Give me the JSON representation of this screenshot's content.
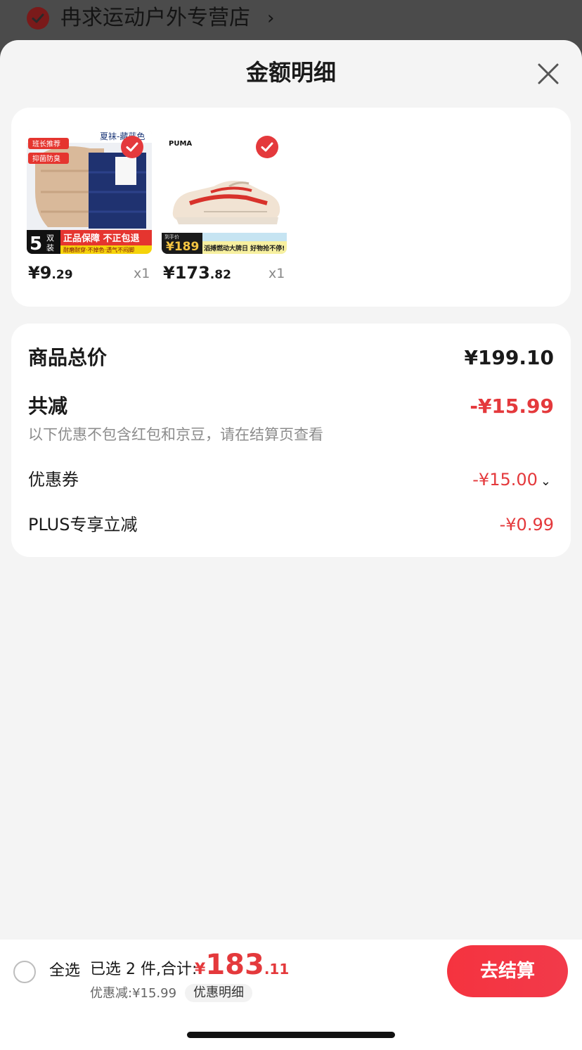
{
  "store": {
    "name": "冉求运动户外专营店",
    "chevron": "›",
    "check_icon": "check-circle-icon"
  },
  "sheet": {
    "title": "金额明细",
    "close_icon": "close-icon"
  },
  "products": [
    {
      "price_int": "¥9",
      "price_dec": ".29",
      "qty": "x1",
      "image_text": {
        "tag1": "班长推荐",
        "tag2": "抑菌防臭",
        "top_label": "夏袜-藏蓝色",
        "count": "5",
        "count_unit_1": "双",
        "count_unit_2": "装",
        "banner": "正品保障 不正包退",
        "sub_banner": "耐磨耐穿·不掉色·透气不闷脚"
      }
    },
    {
      "price_int": "¥173",
      "price_dec": ".82",
      "qty": "x1",
      "image_text": {
        "brand": "PUMA",
        "promo_small": "到手价",
        "promo_price": "¥189",
        "promo_banner": "滔搏燃动大牌日 好物抢不停!"
      }
    }
  ],
  "summary": {
    "total_label": "商品总价",
    "total_value": "¥199.10",
    "reduce_label": "共减",
    "reduce_value": "-¥15.99",
    "note": "以下优惠不包含红包和京豆，请在结算页查看",
    "coupon_label": "优惠券",
    "coupon_value": "-¥15.00",
    "coupon_caret": "⌄",
    "plus_label": "PLUS专享立减",
    "plus_value": "-¥0.99"
  },
  "bottom": {
    "select_all": "全选",
    "selected_text": "已选 2 件,合计:",
    "total_currency": "¥",
    "total_int": "183",
    "total_dec": ".11",
    "discount_text": "优惠减:¥15.99",
    "detail_button": "优惠明细",
    "checkout_button": "去结算"
  },
  "colors": {
    "accent_red": "#e4393c",
    "sheet_bg": "#f4f4f4",
    "card_bg": "#ffffff"
  }
}
